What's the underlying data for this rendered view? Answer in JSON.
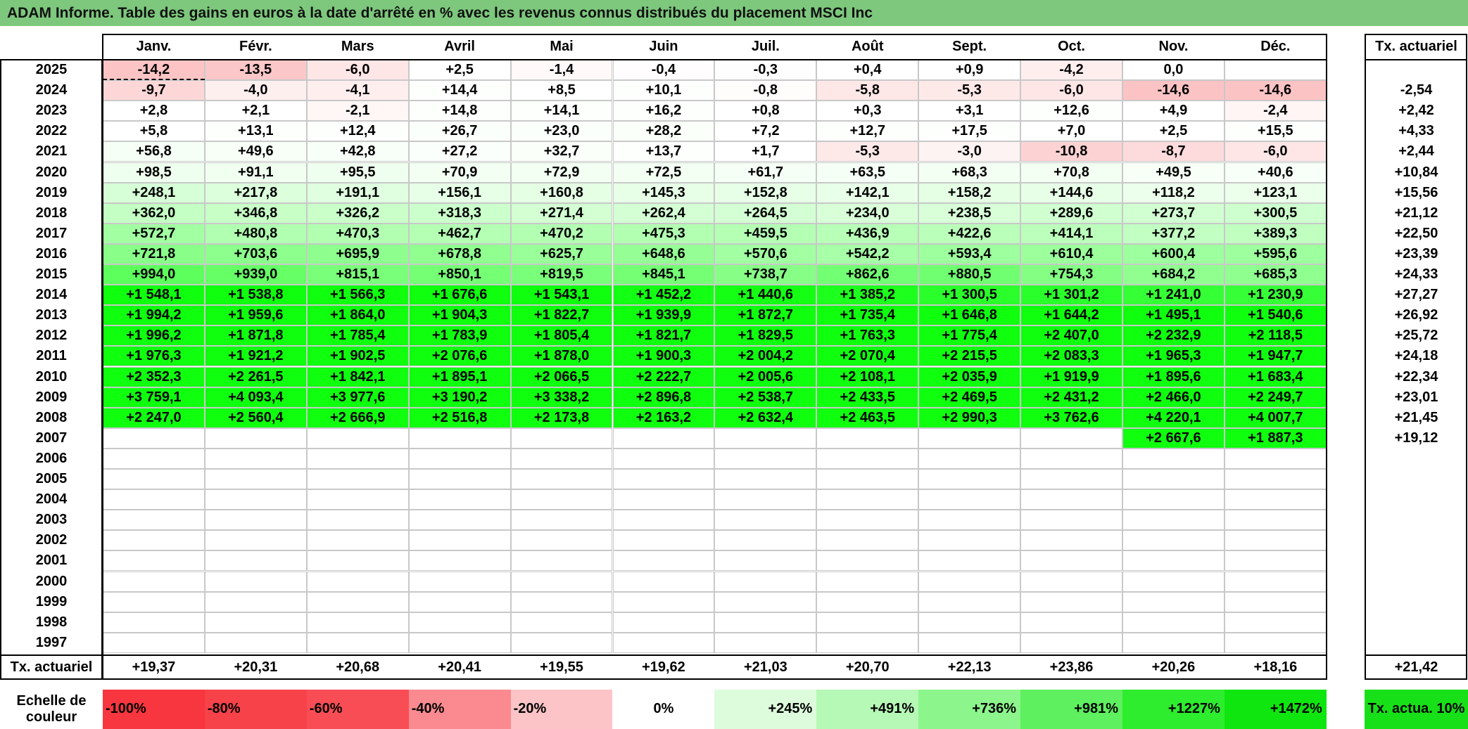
{
  "title": "ADAM Informe. Table des gains en euros à la date d'arrêté en % avec les revenus connus distribués du placement MSCI Inc",
  "months": [
    "Janv.",
    "Févr.",
    "Mars",
    "Avril",
    "Mai",
    "Juin",
    "Juil.",
    "Août",
    "Sept.",
    "Oct.",
    "Nov.",
    "Déc."
  ],
  "actuarial_header": "Tx. actuariel",
  "rows": [
    {
      "year": "2025",
      "values": [
        "-14,2",
        "-13,5",
        "-6,0",
        "+2,5",
        "-1,4",
        "-0,4",
        "-0,3",
        "+0,4",
        "+0,9",
        "-4,2",
        "0,0",
        ""
      ],
      "rate": ""
    },
    {
      "year": "2024",
      "values": [
        "-9,7",
        "-4,0",
        "-4,1",
        "+14,4",
        "+8,5",
        "+10,1",
        "-0,8",
        "-5,8",
        "-5,3",
        "-6,0",
        "-14,6",
        "-14,6"
      ],
      "rate": "-2,54"
    },
    {
      "year": "2023",
      "values": [
        "+2,8",
        "+2,1",
        "-2,1",
        "+14,8",
        "+14,1",
        "+16,2",
        "+0,8",
        "+0,3",
        "+3,1",
        "+12,6",
        "+4,9",
        "-2,4"
      ],
      "rate": "+2,42"
    },
    {
      "year": "2022",
      "values": [
        "+5,8",
        "+13,1",
        "+12,4",
        "+26,7",
        "+23,0",
        "+28,2",
        "+7,2",
        "+12,7",
        "+17,5",
        "+7,0",
        "+2,5",
        "+15,5"
      ],
      "rate": "+4,33"
    },
    {
      "year": "2021",
      "values": [
        "+56,8",
        "+49,6",
        "+42,8",
        "+27,2",
        "+32,7",
        "+13,7",
        "+1,7",
        "-5,3",
        "-3,0",
        "-10,8",
        "-8,7",
        "-6,0"
      ],
      "rate": "+2,44"
    },
    {
      "year": "2020",
      "values": [
        "+98,5",
        "+91,1",
        "+95,5",
        "+70,9",
        "+72,9",
        "+72,5",
        "+61,7",
        "+63,5",
        "+68,3",
        "+70,8",
        "+49,5",
        "+40,6"
      ],
      "rate": "+10,84"
    },
    {
      "year": "2019",
      "values": [
        "+248,1",
        "+217,8",
        "+191,1",
        "+156,1",
        "+160,8",
        "+145,3",
        "+152,8",
        "+142,1",
        "+158,2",
        "+144,6",
        "+118,2",
        "+123,1"
      ],
      "rate": "+15,56"
    },
    {
      "year": "2018",
      "values": [
        "+362,0",
        "+346,8",
        "+326,2",
        "+318,3",
        "+271,4",
        "+262,4",
        "+264,5",
        "+234,0",
        "+238,5",
        "+289,6",
        "+273,7",
        "+300,5"
      ],
      "rate": "+21,12"
    },
    {
      "year": "2017",
      "values": [
        "+572,7",
        "+480,8",
        "+470,3",
        "+462,7",
        "+470,2",
        "+475,3",
        "+459,5",
        "+436,9",
        "+422,6",
        "+414,1",
        "+377,2",
        "+389,3"
      ],
      "rate": "+22,50"
    },
    {
      "year": "2016",
      "values": [
        "+721,8",
        "+703,6",
        "+695,9",
        "+678,8",
        "+625,7",
        "+648,6",
        "+570,6",
        "+542,2",
        "+593,4",
        "+610,4",
        "+600,4",
        "+595,6"
      ],
      "rate": "+23,39"
    },
    {
      "year": "2015",
      "values": [
        "+994,0",
        "+939,0",
        "+815,1",
        "+850,1",
        "+819,5",
        "+845,1",
        "+738,7",
        "+862,6",
        "+880,5",
        "+754,3",
        "+684,2",
        "+685,3"
      ],
      "rate": "+24,33"
    },
    {
      "year": "2014",
      "values": [
        "+1 548,1",
        "+1 538,8",
        "+1 566,3",
        "+1 676,6",
        "+1 543,1",
        "+1 452,2",
        "+1 440,6",
        "+1 385,2",
        "+1 300,5",
        "+1 301,2",
        "+1 241,0",
        "+1 230,9"
      ],
      "rate": "+27,27"
    },
    {
      "year": "2013",
      "values": [
        "+1 994,2",
        "+1 959,6",
        "+1 864,0",
        "+1 904,3",
        "+1 822,7",
        "+1 939,9",
        "+1 872,7",
        "+1 735,4",
        "+1 646,8",
        "+1 644,2",
        "+1 495,1",
        "+1 540,6"
      ],
      "rate": "+26,92"
    },
    {
      "year": "2012",
      "values": [
        "+1 996,2",
        "+1 871,8",
        "+1 785,4",
        "+1 783,9",
        "+1 805,4",
        "+1 821,7",
        "+1 829,5",
        "+1 763,3",
        "+1 775,4",
        "+2 407,0",
        "+2 232,9",
        "+2 118,5"
      ],
      "rate": "+25,72"
    },
    {
      "year": "2011",
      "values": [
        "+1 976,3",
        "+1 921,2",
        "+1 902,5",
        "+2 076,6",
        "+1 878,0",
        "+1 900,3",
        "+2 004,2",
        "+2 070,4",
        "+2 215,5",
        "+2 083,3",
        "+1 965,3",
        "+1 947,7"
      ],
      "rate": "+24,18"
    },
    {
      "year": "2010",
      "values": [
        "+2 352,3",
        "+2 261,5",
        "+1 842,1",
        "+1 895,1",
        "+2 066,5",
        "+2 222,7",
        "+2 005,6",
        "+2 108,1",
        "+2 035,9",
        "+1 919,9",
        "+1 895,6",
        "+1 683,4"
      ],
      "rate": "+22,34"
    },
    {
      "year": "2009",
      "values": [
        "+3 759,1",
        "+4 093,4",
        "+3 977,6",
        "+3 190,2",
        "+3 338,2",
        "+2 896,8",
        "+2 538,7",
        "+2 433,5",
        "+2 469,5",
        "+2 431,2",
        "+2 466,0",
        "+2 249,7"
      ],
      "rate": "+23,01"
    },
    {
      "year": "2008",
      "values": [
        "+2 247,0",
        "+2 560,4",
        "+2 666,9",
        "+2 516,8",
        "+2 173,8",
        "+2 163,2",
        "+2 632,4",
        "+2 463,5",
        "+2 990,3",
        "+3 762,6",
        "+4 220,1",
        "+4 007,7"
      ],
      "rate": "+21,45"
    },
    {
      "year": "2007",
      "values": [
        "",
        "",
        "",
        "",
        "",
        "",
        "",
        "",
        "",
        "",
        "+2 667,6",
        "+1 887,3"
      ],
      "rate": "+19,12"
    },
    {
      "year": "2006",
      "values": [
        "",
        "",
        "",
        "",
        "",
        "",
        "",
        "",
        "",
        "",
        "",
        ""
      ],
      "rate": ""
    },
    {
      "year": "2005",
      "values": [
        "",
        "",
        "",
        "",
        "",
        "",
        "",
        "",
        "",
        "",
        "",
        ""
      ],
      "rate": ""
    },
    {
      "year": "2004",
      "values": [
        "",
        "",
        "",
        "",
        "",
        "",
        "",
        "",
        "",
        "",
        "",
        ""
      ],
      "rate": ""
    },
    {
      "year": "2003",
      "values": [
        "",
        "",
        "",
        "",
        "",
        "",
        "",
        "",
        "",
        "",
        "",
        ""
      ],
      "rate": ""
    },
    {
      "year": "2002",
      "values": [
        "",
        "",
        "",
        "",
        "",
        "",
        "",
        "",
        "",
        "",
        "",
        ""
      ],
      "rate": ""
    },
    {
      "year": "2001",
      "values": [
        "",
        "",
        "",
        "",
        "",
        "",
        "",
        "",
        "",
        "",
        "",
        ""
      ],
      "rate": ""
    },
    {
      "year": "2000",
      "values": [
        "",
        "",
        "",
        "",
        "",
        "",
        "",
        "",
        "",
        "",
        "",
        ""
      ],
      "rate": ""
    },
    {
      "year": "1999",
      "values": [
        "",
        "",
        "",
        "",
        "",
        "",
        "",
        "",
        "",
        "",
        "",
        ""
      ],
      "rate": ""
    },
    {
      "year": "1998",
      "values": [
        "",
        "",
        "",
        "",
        "",
        "",
        "",
        "",
        "",
        "",
        "",
        ""
      ],
      "rate": ""
    },
    {
      "year": "1997",
      "values": [
        "",
        "",
        "",
        "",
        "",
        "",
        "",
        "",
        "",
        "",
        "",
        ""
      ],
      "rate": ""
    }
  ],
  "footer": {
    "label": "Tx. actuariel",
    "values": [
      "+19,37",
      "+20,31",
      "+20,68",
      "+20,41",
      "+19,55",
      "+19,62",
      "+21,03",
      "+20,70",
      "+22,13",
      "+23,86",
      "+20,26",
      "+18,16"
    ],
    "total": "+21,42"
  },
  "legend": {
    "label": "Echelle de couleur",
    "items": [
      {
        "text": "-100%",
        "color": "#f8363f"
      },
      {
        "text": "-80%",
        "color": "#f8424a"
      },
      {
        "text": "-60%",
        "color": "#f94d55"
      },
      {
        "text": "-40%",
        "color": "#fa8a8f"
      },
      {
        "text": "-20%",
        "color": "#fcc4c6"
      },
      {
        "text": "0%",
        "color": "#ffffff"
      },
      {
        "text": "+245%",
        "color": "#dcfcdc"
      },
      {
        "text": "+491%",
        "color": "#b6f8b6"
      },
      {
        "text": "+736%",
        "color": "#8cf58c"
      },
      {
        "text": "+981%",
        "color": "#5ef05e"
      },
      {
        "text": "+1227%",
        "color": "#2eec2e"
      },
      {
        "text": "+1472%",
        "color": "#0fe60f"
      }
    ],
    "rate_label": "Tx. actua. 10%",
    "rate_color": "#18e018"
  },
  "colors": {
    "title_bg": "#7dc87d",
    "negative_max": "#f8696b",
    "positive_max": "#00ff00",
    "neutral": "#ffffff"
  }
}
